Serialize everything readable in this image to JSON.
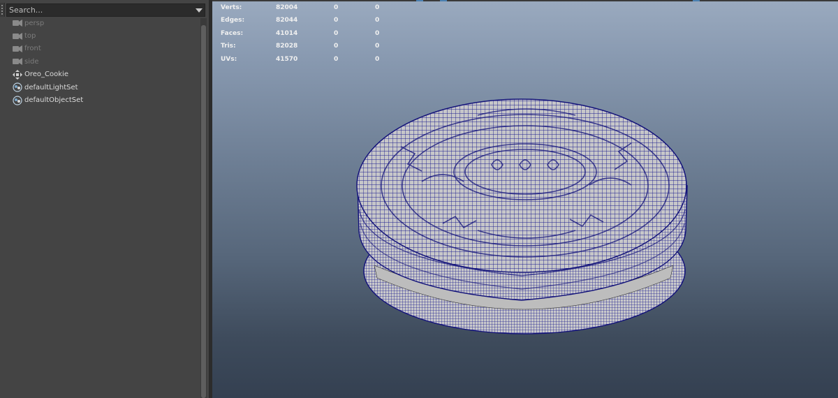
{
  "outliner": {
    "search_placeholder": "Search...",
    "items": [
      {
        "label": "persp",
        "icon": "camera-icon",
        "dim": true
      },
      {
        "label": "top",
        "icon": "camera-icon",
        "dim": true
      },
      {
        "label": "front",
        "icon": "camera-icon",
        "dim": true
      },
      {
        "label": "side",
        "icon": "camera-icon",
        "dim": true
      },
      {
        "label": "Oreo_Cookie",
        "icon": "transform-icon",
        "dim": false
      },
      {
        "label": "defaultLightSet",
        "icon": "set-icon",
        "dim": false
      },
      {
        "label": "defaultObjectSet",
        "icon": "set-icon",
        "dim": false
      }
    ]
  },
  "heads_up_display": {
    "rows": [
      {
        "label": "Verts:",
        "a": "82004",
        "b": "0",
        "c": "0"
      },
      {
        "label": "Edges:",
        "a": "82044",
        "b": "0",
        "c": "0"
      },
      {
        "label": "Faces:",
        "a": "41014",
        "b": "0",
        "c": "0"
      },
      {
        "label": "Tris:",
        "a": "82028",
        "b": "0",
        "c": "0"
      },
      {
        "label": "UVs:",
        "a": "41570",
        "b": "0",
        "c": "0"
      }
    ]
  },
  "viewport": {
    "wireframe_color": "#1a1a8c",
    "mesh_fill_color": "#c4c4c4",
    "background_top": "#9aaabf",
    "background_bottom": "#344051"
  }
}
